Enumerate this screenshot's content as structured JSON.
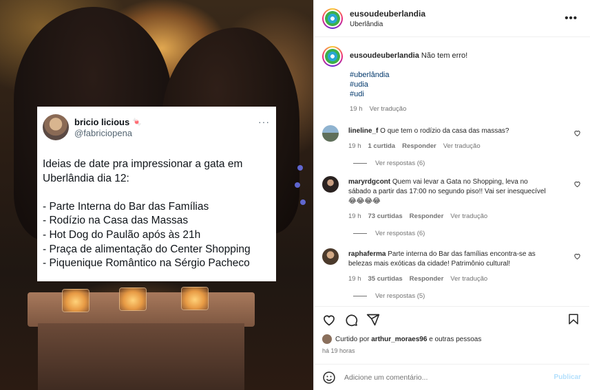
{
  "tweet": {
    "name": "bricio licious",
    "name_emoji": "🍬",
    "handle": "@fabriciopena",
    "more": "···",
    "intro_line1": "Ideias de date pra impressionar a gata em",
    "intro_line2": "Uberlândia dia 12:",
    "items": [
      "- Parte Interna do Bar das Famílias",
      "- Rodízio na Casa das Massas",
      "- Hot Dog do Paulão após às 21h",
      "- Praça de alimentação do Center Shopping",
      "- Piquenique Romântico na Sérgio Pacheco"
    ]
  },
  "post": {
    "username": "eusoudeuberlandia",
    "location": "Uberlândia",
    "more": "•••",
    "caption_text": "Não tem erro!",
    "hashtags": [
      "#uberlândia",
      "#udia",
      "#udi"
    ],
    "caption_time": "19 h",
    "see_translation": "Ver tradução"
  },
  "comments": [
    {
      "user": "lineline_f",
      "text": "O que tem o rodízio da casa das massas?",
      "time": "19 h",
      "likes": "1 curtida",
      "reply": "Responder",
      "translate": "Ver tradução",
      "replies": "Ver respostas (6)"
    },
    {
      "user": "maryrdgcont",
      "text": "Quem vai levar a Gata no Shopping, leva no sábado a partir das 17:00 no segundo piso!! Vai ser inesquecível 😂😂😂😂",
      "time": "19 h",
      "likes": "73 curtidas",
      "reply": "Responder",
      "translate": "Ver tradução",
      "replies": "Ver respostas (6)"
    },
    {
      "user": "raphaferma",
      "text": "Parte interna do Bar das famílias encontra-se as belezas mais exóticas da cidade! Patrimônio cultural!",
      "time": "19 h",
      "likes": "35 curtidas",
      "reply": "Responder",
      "translate": "Ver tradução",
      "replies": "Ver respostas (5)"
    }
  ],
  "likes": {
    "prefix": "Curtido por",
    "user": "arthur_moraes96",
    "suffix": "e outras pessoas",
    "time_ago": "há 19 horas"
  },
  "composer": {
    "placeholder": "Adicione um comentário...",
    "publish": "Publicar"
  },
  "icons": [
    "heart-icon",
    "comment-icon",
    "share-icon",
    "bookmark-icon",
    "emoji-icon",
    "more-icon"
  ],
  "colors": {
    "link": "#00376b",
    "muted": "#737373",
    "publish": "#b2dffc"
  }
}
